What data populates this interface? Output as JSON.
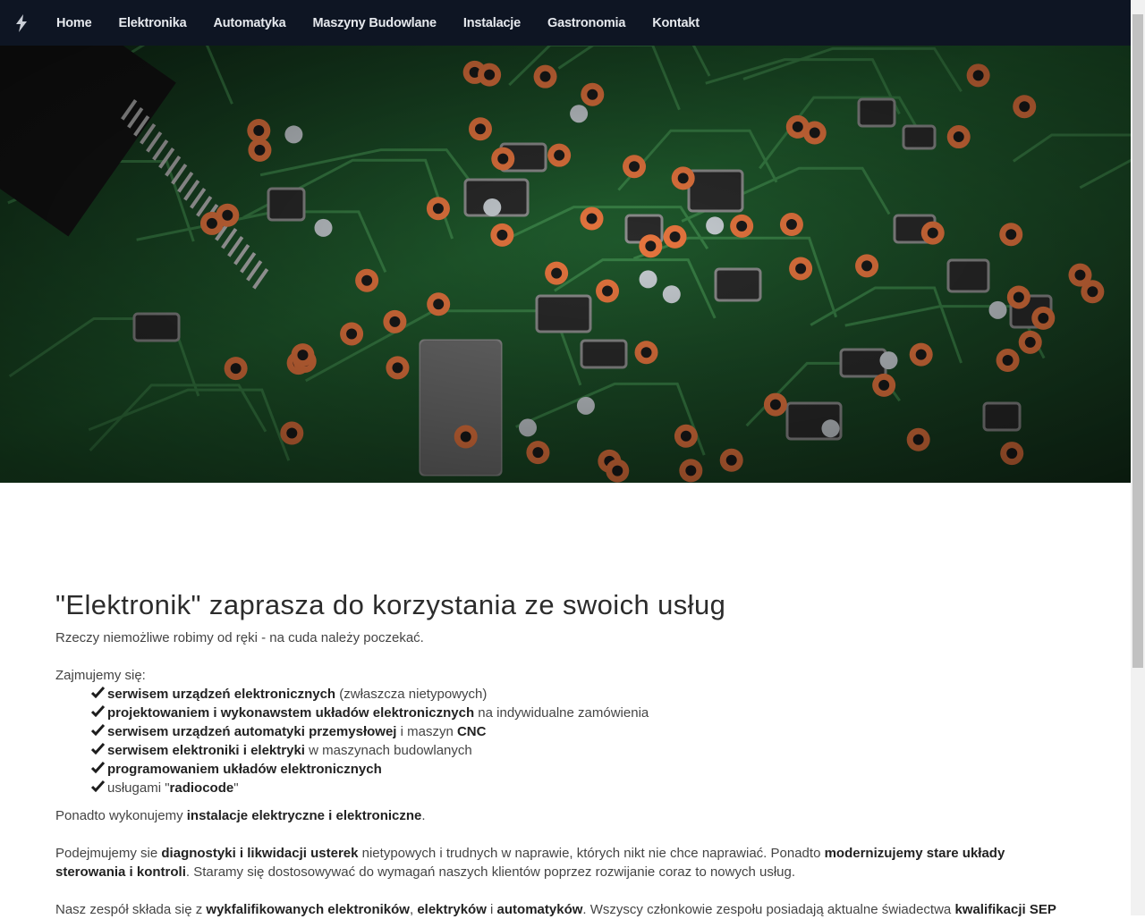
{
  "nav": {
    "items": [
      "Home",
      "Elektronika",
      "Automatyka",
      "Maszyny Budowlane",
      "Instalacje",
      "Gastronomia",
      "Kontakt"
    ]
  },
  "main": {
    "title": "\"Elektronik\" zaprasza do korzystania ze swoich usług",
    "subtitle": "Rzeczy niemożliwe robimy od ręki - na cuda należy poczekać.",
    "intro": "Zajmujemy się:",
    "services": [
      {
        "bold": "serwisem urządzeń elektronicznych",
        "rest": " (zwłaszcza nietypowych)"
      },
      {
        "bold": "projektowaniem i wykonawstem układów elektronicznych",
        "rest": " na indywidualne zamówienia"
      },
      {
        "bold": "serwisem urządzeń automatyki przemysłowej",
        "mid": " i maszyn ",
        "bold2": "CNC"
      },
      {
        "bold": "serwisem elektroniki i elektryki",
        "rest": " w maszynach budowlanych"
      },
      {
        "bold": "programowaniem układów elektronicznych",
        "rest": ""
      },
      {
        "pre": "usługami \"",
        "bold": "radiocode",
        "rest": "\""
      }
    ],
    "para1": {
      "pre": "Ponadto wykonujemy ",
      "bold": "instalacje elektryczne i elektroniczne",
      "post": "."
    },
    "para2": {
      "pre": "Podejmujemy sie ",
      "bold1": "diagnostyki i likwidacji usterek",
      "mid": " nietypowych i trudnych w naprawie, których nikt nie chce naprawiać. Ponadto ",
      "bold2": "modernizujemy stare układy sterowania i kontroli",
      "post": ". Staramy się dostosowywać do wymagań naszych klientów poprzez rozwijanie coraz to nowych usług."
    },
    "para3": {
      "pre": "Nasz zespół składa się z ",
      "bold1": "wykfalifikowanych elektroników",
      "s1": ", ",
      "bold2": "elektryków",
      "s2": " i ",
      "bold3": "automatyków",
      "mid": ". Wszyscy członkowie zespołu posiadają aktualne świadectwa ",
      "bold4": "kwalifikacji SEP"
    }
  },
  "icons": {
    "brand": "bolt-icon",
    "check": "check-icon"
  },
  "colors": {
    "navbar": "#0e1523",
    "nav_text": "#e6e9ee",
    "pcb_green": "#1f5a2c",
    "pad_copper": "#e8763f"
  }
}
